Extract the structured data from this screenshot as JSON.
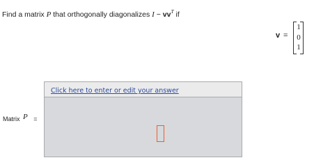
{
  "question": {
    "prefix": "Find a matrix ",
    "matrix_symbol": "P",
    "middle": " that orthogonally diagonalizes ",
    "identity_symbol": "I",
    "minus": " − ",
    "vec_product": "vv",
    "transpose": "T",
    "suffix": " if"
  },
  "vector": {
    "name": "v",
    "equals": "=",
    "entries": [
      "1",
      "0",
      "1"
    ]
  },
  "answer": {
    "label": "Matrix",
    "symbol": "P",
    "equals": "=",
    "link_text": "Click here to enter or edit your answer"
  },
  "colors": {
    "link": "#2b4a9e",
    "answer_background": "#d7d9dc",
    "placeholder_border": "#e8602c"
  }
}
